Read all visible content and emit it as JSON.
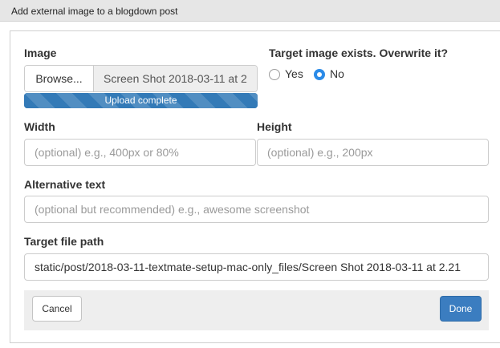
{
  "window": {
    "title": "Add external image to a blogdown post"
  },
  "image": {
    "label": "Image",
    "browse_label": "Browse...",
    "file_name": "Screen Shot 2018-03-11 at 2",
    "progress": {
      "text": "Upload complete",
      "percent": 100
    }
  },
  "overwrite": {
    "question": "Target image exists. Overwrite it?",
    "options": [
      {
        "label": "Yes",
        "selected": false
      },
      {
        "label": "No",
        "selected": true
      }
    ]
  },
  "width": {
    "label": "Width",
    "placeholder": "(optional) e.g., 400px or 80%"
  },
  "height": {
    "label": "Height",
    "placeholder": "(optional) e.g., 200px"
  },
  "alt_text": {
    "label": "Alternative text",
    "placeholder": "(optional but recommended) e.g., awesome screenshot"
  },
  "target_path": {
    "label": "Target file path",
    "value": "static/post/2018-03-11-textmate-setup-mac-only_files/Screen Shot 2018-03-11 at 2.21"
  },
  "footer": {
    "cancel_label": "Cancel",
    "done_label": "Done"
  },
  "colors": {
    "primary": "#337ab7",
    "radio_selected": "#2b8be8",
    "done_button": "#3b7dc0"
  }
}
